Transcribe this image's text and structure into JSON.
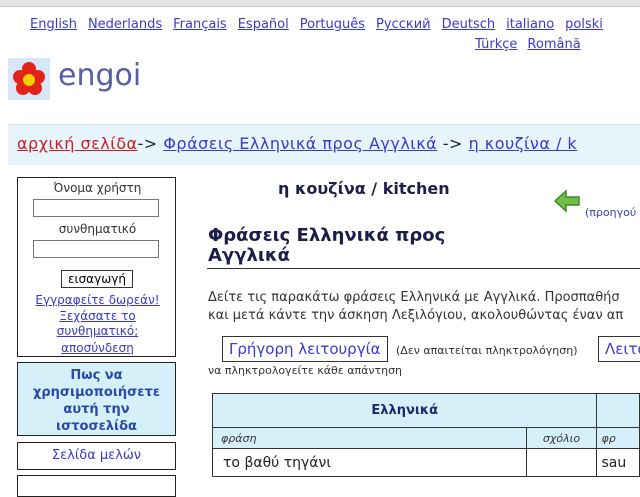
{
  "languages": {
    "row1": [
      "English",
      "Nederlands",
      "Français",
      "Español",
      "Português",
      "Русский",
      "Deutsch",
      "italiano",
      "polski"
    ],
    "row2": [
      "Türkçe",
      "Română"
    ]
  },
  "brand": "engoi",
  "breadcrumb": {
    "home": "αρχική σελίδα",
    "sep1": "->",
    "level1": "Φράσεις Ελληνικά προς Αγγλικά",
    "sep2": "->",
    "level2": "η κουζίνα / k"
  },
  "login": {
    "username_label": "Όνομα χρήστη",
    "password_label": "συνθηματικό",
    "submit_label": "εισαγωγή",
    "register_link": "Εγγραφείτε δωρεάν!",
    "forgot_link": "Ξεχάσατε το συνθηματικό;",
    "logout_link": "αποσύνδεση"
  },
  "sidebar": {
    "help": "Πως να χρησιμοποιήσετε αυτή την ιστοσελίδα",
    "members": "Σελίδα μελών"
  },
  "page": {
    "title": "η κουζίνα / kitchen",
    "previous": "(προηγού",
    "heading": "Φράσεις Ελληνικά προς Αγγλικά",
    "intro_line1": "Δείτε τις παρακάτω φράσεις Ελληνικά με Αγγλικά. Προσπαθήσ",
    "intro_line2": "και μετά κάντε την άσκηση Λεξιλόγιου, ακολουθώντας έναν απ",
    "quick_button": "Γρήγορη λειτουργία",
    "quick_note": "(Δεν απαιτείται πληκτρολόγηση)",
    "other_button": "Λειτο",
    "type_note": "να πληκτρολογείτε κάθε απάντηση"
  },
  "table": {
    "lang_header": "Ελληνικά",
    "col_phrase": "φράση",
    "col_comment": "σχόλιο",
    "col_phrase2": "φρ",
    "rows": [
      {
        "phrase": "το βαθύ τηγάνι",
        "comment": "",
        "english": "sau"
      }
    ]
  }
}
